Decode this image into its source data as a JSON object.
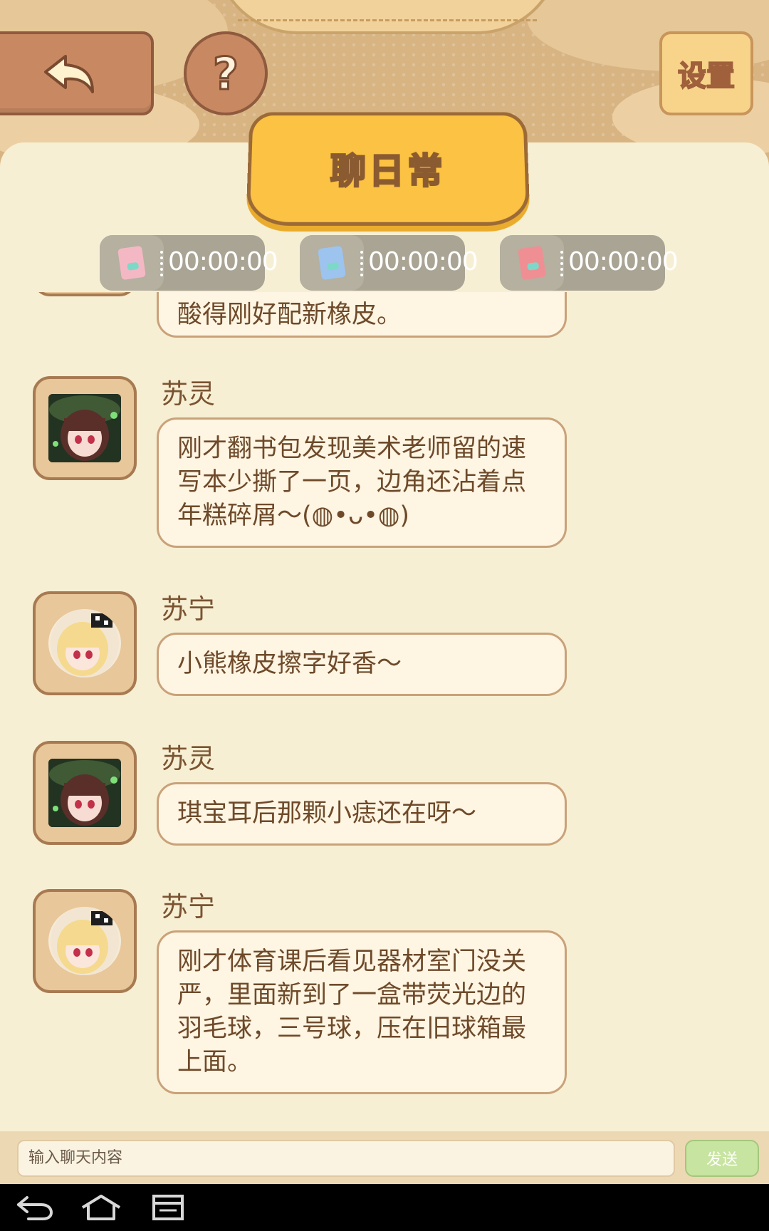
{
  "header": {
    "settings_label": "设置",
    "help_label": "?",
    "title": "聊日常"
  },
  "timers": [
    {
      "icon": "pink-card-icon",
      "color": "#f4b8c4",
      "value": "00:00:00"
    },
    {
      "icon": "blue-card-icon",
      "color": "#9cc4ee",
      "value": "00:00:00"
    },
    {
      "icon": "red-card-icon",
      "color": "#ef8f94",
      "value": "00:00:00"
    }
  ],
  "messages": [
    {
      "name": "",
      "avatar": "",
      "text": "酸得刚好配新橡皮。"
    },
    {
      "name": "苏灵",
      "avatar": "suling-avatar",
      "text": "刚才翻书包发现美术老师留的速写本少撕了一页，边角还沾着点年糕碎屑～(◍•ᴗ•◍)"
    },
    {
      "name": "苏宁",
      "avatar": "suning-avatar",
      "text": "小熊橡皮擦字好香～"
    },
    {
      "name": "苏灵",
      "avatar": "suling-avatar",
      "text": "琪宝耳后那颗小痣还在呀～"
    },
    {
      "name": "苏宁",
      "avatar": "suning-avatar",
      "text": "刚才体育课后看见器材室门没关严，里面新到了一盒带荧光边的羽毛球，三号球，压在旧球箱最上面。"
    }
  ],
  "input": {
    "placeholder": "输入聊天内容",
    "send_label": "发送"
  },
  "colors": {
    "panel": "#f7efd3",
    "header": "#d8b483",
    "title_banner": "#fbc243",
    "send_button": "#c7e4a0"
  },
  "nav": {
    "back": "back-icon",
    "home": "home-icon",
    "recents": "recents-icon"
  }
}
